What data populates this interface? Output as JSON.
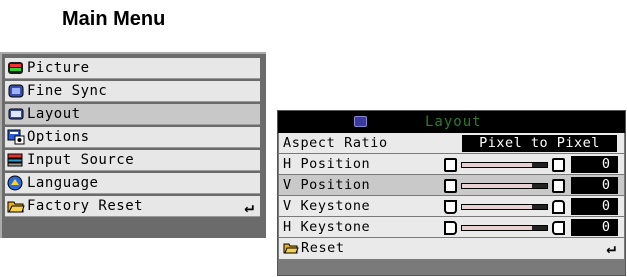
{
  "main_title": "Main Menu",
  "main_menu": {
    "items": [
      {
        "label": "Picture",
        "icon": "picture-icon"
      },
      {
        "label": "Fine Sync",
        "icon": "fine-sync-icon"
      },
      {
        "label": "Layout",
        "icon": "layout-icon",
        "selected": true
      },
      {
        "label": "Options",
        "icon": "options-icon"
      },
      {
        "label": "Input Source",
        "icon": "input-source-icon"
      },
      {
        "label": "Language",
        "icon": "language-icon"
      },
      {
        "label": "Factory Reset",
        "icon": "factory-reset-icon",
        "return_glyph": "↵"
      }
    ]
  },
  "layout_panel": {
    "title": "Layout",
    "aspect_ratio": {
      "label": "Aspect Ratio",
      "value": "Pixel to Pixel"
    },
    "rows": [
      {
        "label": "H Position",
        "value": "0",
        "level": 0.0
      },
      {
        "label": "V Position",
        "value": "0",
        "level": 0.0
      },
      {
        "label": "V Keystone",
        "value": "0",
        "level": 0.0
      },
      {
        "label": "H Keystone",
        "value": "0",
        "level": 0.0
      }
    ],
    "reset": {
      "label": "Reset",
      "return_glyph": "↵"
    }
  },
  "colors": {
    "panel_title": "#2c7a2c",
    "selected_row": "#c9c9c9",
    "value_box": "#000000"
  }
}
